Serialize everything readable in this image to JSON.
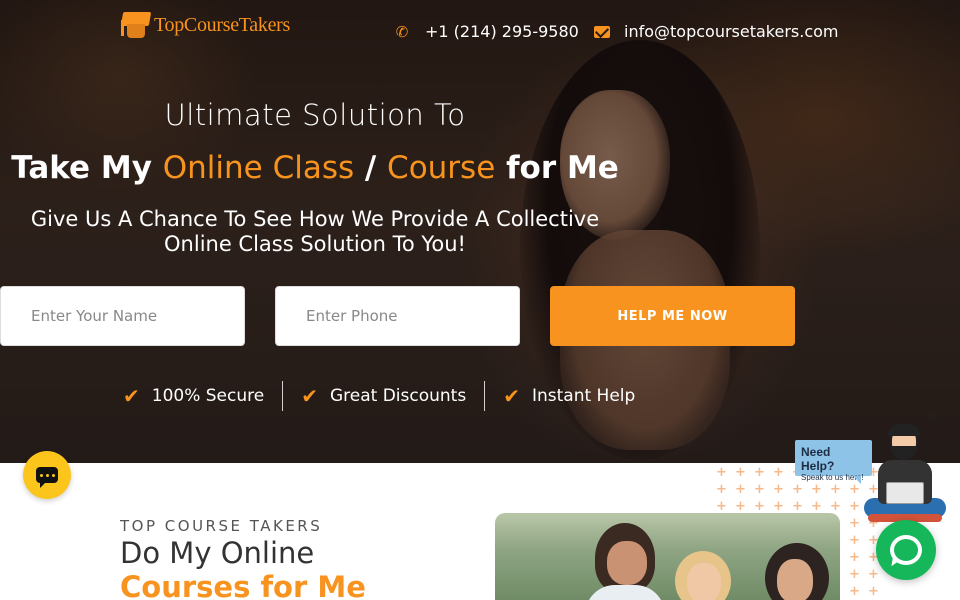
{
  "brand": {
    "name": "TopCourseTakers",
    "accent": "#f7931e"
  },
  "header": {
    "phone": "+1 (214) 295-9580",
    "email": "info@topcoursetakers.com",
    "phone_icon": "phone-icon",
    "email_icon": "envelope-icon"
  },
  "hero": {
    "subtitle": "Ultimate Solution To",
    "title_part1": "Take My ",
    "title_accent1": "Online Class",
    "title_sep": " / ",
    "title_accent2": "Course",
    "title_part2": " for Me",
    "description_line1": "Give Us A Chance To See How We Provide A Collective",
    "description_line2": "Online Class Solution To You!"
  },
  "form": {
    "name_placeholder": "Enter Your Name",
    "phone_placeholder": "Enter Phone",
    "submit_label": "HELP ME NOW"
  },
  "features": [
    {
      "label": "100% Secure"
    },
    {
      "label": "Great Discounts"
    },
    {
      "label": "Instant Help"
    }
  ],
  "section": {
    "eyebrow": "TOP COURSE TAKERS",
    "title_line1": "Do My Online",
    "title_line2": "Courses for Me"
  },
  "help_widget": {
    "title": "Need Help?",
    "subtitle": "Speak to us here!",
    "close": "×"
  }
}
